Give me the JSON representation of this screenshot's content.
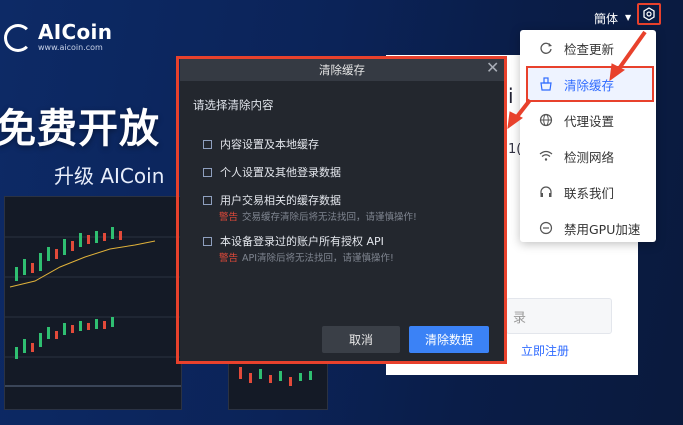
{
  "background": {
    "brand_name": "AICoin",
    "brand_url": "www.aicoin.com",
    "hero_title": "免费开放",
    "hero_subtitle": "升级 AICoin",
    "right_panel_letter": "i",
    "right_panel_number": "1(",
    "input_placeholder_fragment": "录",
    "register_link_fragment": "立即注册"
  },
  "topbar": {
    "language": "簡体",
    "settings_icon": "gear-icon"
  },
  "menu": {
    "items": [
      {
        "label": "检查更新",
        "icon": "refresh-icon"
      },
      {
        "label": "清除缓存",
        "icon": "broom-icon"
      },
      {
        "label": "代理设置",
        "icon": "globe-icon"
      },
      {
        "label": "检测网络",
        "icon": "wifi-icon"
      },
      {
        "label": "联系我们",
        "icon": "headset-icon"
      },
      {
        "label": "禁用GPU加速",
        "icon": "minus-circle-icon"
      }
    ],
    "active_index": 1
  },
  "dialog": {
    "title": "清除缓存",
    "prompt": "请选择清除内容",
    "options": [
      {
        "label": "内容设置及本地缓存",
        "checked": false
      },
      {
        "label": "个人设置及其他登录数据",
        "checked": false
      },
      {
        "label": "用户交易相关的缓存数据",
        "checked": false,
        "warning_tag": "警告",
        "warning_text": "交易缓存清除后将无法找回，请谨慎操作!"
      },
      {
        "label": "本设备登录过的账户所有授权 API",
        "checked": false,
        "warning_tag": "警告",
        "warning_text": "API清除后将无法找回，请谨慎操作!"
      }
    ],
    "cancel_label": "取消",
    "confirm_label": "清除数据"
  },
  "colors": {
    "highlight_red": "#e8412c",
    "accent_blue": "#3b82f6",
    "dialog_bg": "#23272e"
  }
}
